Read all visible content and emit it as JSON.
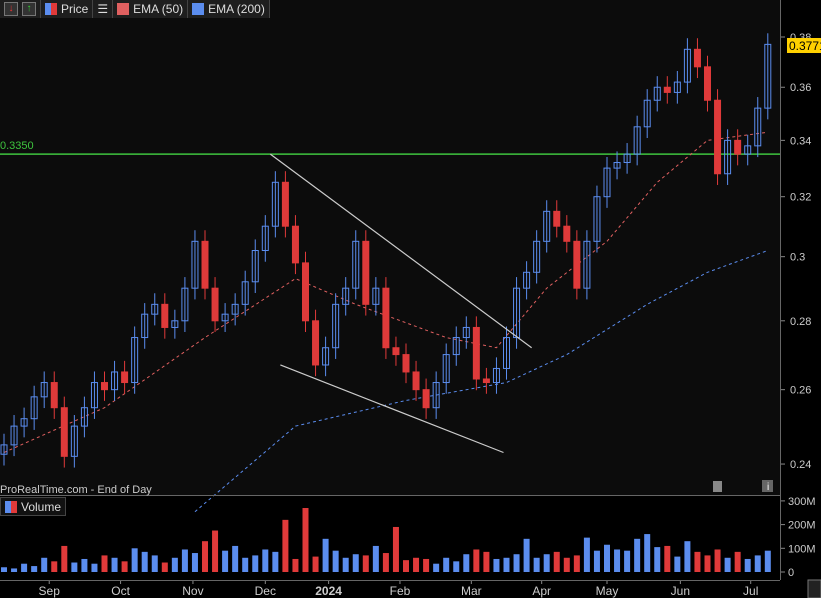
{
  "legend": {
    "price": "Price",
    "ema50": "EMA (50)",
    "ema200": "EMA (200)",
    "volume": "Volume"
  },
  "watermark": "ProRealTime.com - End of Day",
  "colors": {
    "up": "#5b8def",
    "down": "#e03a3a",
    "ema50": "#e06060",
    "ema200": "#5b8def",
    "level": "#3ec43e",
    "badge": "#ffd000"
  },
  "chart_data": {
    "type": "candlestick",
    "price_axis": {
      "scale": "log",
      "ylim": [
        0.232,
        0.386
      ],
      "ticks": [
        "0.24",
        "0.26",
        "0.28",
        "0.3",
        "0.32",
        "0.34",
        "0.36",
        "0.38"
      ]
    },
    "last_price": "0.3771",
    "level_line": {
      "value": 0.335,
      "label": "0.3350"
    },
    "month_ticks": [
      {
        "label": "Sep",
        "index": 4.5
      },
      {
        "label": "Oct",
        "index": 11.6
      },
      {
        "label": "Nov",
        "index": 18.8
      },
      {
        "label": "Dec",
        "index": 26
      },
      {
        "label": "2024",
        "index": 32.3
      },
      {
        "label": "Feb",
        "index": 39.4
      },
      {
        "label": "Mar",
        "index": 46.5
      },
      {
        "label": "Apr",
        "index": 53.5
      },
      {
        "label": "May",
        "index": 60
      },
      {
        "label": "Jun",
        "index": 67.3
      },
      {
        "label": "Jul",
        "index": 74.3
      }
    ],
    "closes": [
      0.245,
      0.25,
      0.252,
      0.258,
      0.262,
      0.255,
      0.242,
      0.25,
      0.255,
      0.262,
      0.26,
      0.265,
      0.262,
      0.275,
      0.282,
      0.285,
      0.278,
      0.28,
      0.29,
      0.305,
      0.29,
      0.28,
      0.282,
      0.285,
      0.292,
      0.302,
      0.31,
      0.325,
      0.31,
      0.298,
      0.28,
      0.267,
      0.272,
      0.285,
      0.29,
      0.305,
      0.285,
      0.29,
      0.272,
      0.27,
      0.265,
      0.26,
      0.255,
      0.262,
      0.27,
      0.275,
      0.278,
      0.263,
      0.262,
      0.266,
      0.275,
      0.29,
      0.295,
      0.305,
      0.315,
      0.31,
      0.305,
      0.29,
      0.305,
      0.32,
      0.33,
      0.332,
      0.335,
      0.345,
      0.355,
      0.36,
      0.358,
      0.362,
      0.375,
      0.368,
      0.355,
      0.328,
      0.34,
      0.335,
      0.338,
      0.352,
      0.377
    ],
    "ema50": [
      [
        0,
        0.243
      ],
      [
        10,
        0.255
      ],
      [
        20,
        0.275
      ],
      [
        29,
        0.293
      ],
      [
        35,
        0.285
      ],
      [
        44,
        0.275
      ],
      [
        49,
        0.272
      ],
      [
        54,
        0.29
      ],
      [
        60,
        0.305
      ],
      [
        65,
        0.325
      ],
      [
        70,
        0.34
      ],
      [
        76,
        0.343
      ]
    ],
    "ema200": [
      [
        19,
        0.228
      ],
      [
        29,
        0.25
      ],
      [
        40,
        0.257
      ],
      [
        50,
        0.262
      ],
      [
        56,
        0.27
      ],
      [
        64,
        0.285
      ],
      [
        70,
        0.295
      ],
      [
        76,
        0.302
      ]
    ],
    "trendlines": [
      [
        [
          26.5,
          0.335
        ],
        [
          52.5,
          0.272
        ]
      ],
      [
        [
          27.5,
          0.267
        ],
        [
          49.7,
          0.243
        ]
      ]
    ],
    "volume_axis": {
      "ylim": [
        0,
        300
      ],
      "ticks": [
        "0",
        "100M",
        "200M",
        "300M"
      ]
    },
    "volumes": [
      20,
      15,
      35,
      25,
      60,
      45,
      110,
      40,
      55,
      35,
      70,
      60,
      45,
      100,
      85,
      70,
      40,
      60,
      95,
      80,
      130,
      175,
      90,
      110,
      60,
      70,
      95,
      85,
      220,
      55,
      270,
      65,
      140,
      90,
      60,
      75,
      70,
      110,
      80,
      190,
      50,
      60,
      55,
      35,
      60,
      45,
      75,
      95,
      85,
      55,
      60,
      75,
      140,
      60,
      75,
      85,
      60,
      70,
      145,
      90,
      115,
      95,
      90,
      140,
      160,
      105,
      110,
      65,
      130,
      85,
      70,
      95,
      60,
      85,
      55,
      70,
      90
    ]
  }
}
